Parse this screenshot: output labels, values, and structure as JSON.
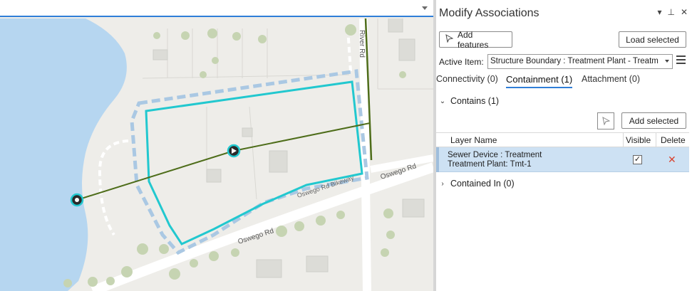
{
  "pane": {
    "title": "Modify Associations",
    "title_icons": [
      "dropdown-icon",
      "pin-icon",
      "close-icon"
    ],
    "add_features_label": "Add features",
    "load_selected_label": "Load selected",
    "active_item_label": "Active Item:",
    "active_item_value": "Structure Boundary : Treatment Plant - Treatm",
    "tabs": [
      {
        "label": "Connectivity (0)",
        "active": false
      },
      {
        "label": "Containment (1)",
        "active": true
      },
      {
        "label": "Attachment (0)",
        "active": false
      }
    ],
    "contains_label": "Contains (1)",
    "add_selected_label": "Add selected",
    "table": {
      "headers": [
        "Layer Name",
        "Visible",
        "Delete"
      ],
      "rows": [
        {
          "line1": "Sewer Device : Treatment",
          "line2": "Treatment Plant: Tmt-1",
          "visible": true
        }
      ]
    },
    "contained_in_label": "Contained In (0)"
  },
  "map": {
    "labels": {
      "river_rd": "River Rd",
      "oswego_rd": "Oswego Rd",
      "oswego_rd_2": "Oswego Rd",
      "oswego_rd_bikeway": "Oswego Rd Bikeway"
    },
    "colors": {
      "water": "#b6d6f0",
      "boundary": "#22c8cf",
      "line": "#4e6d1a",
      "buffer": "#aac8e3"
    }
  }
}
